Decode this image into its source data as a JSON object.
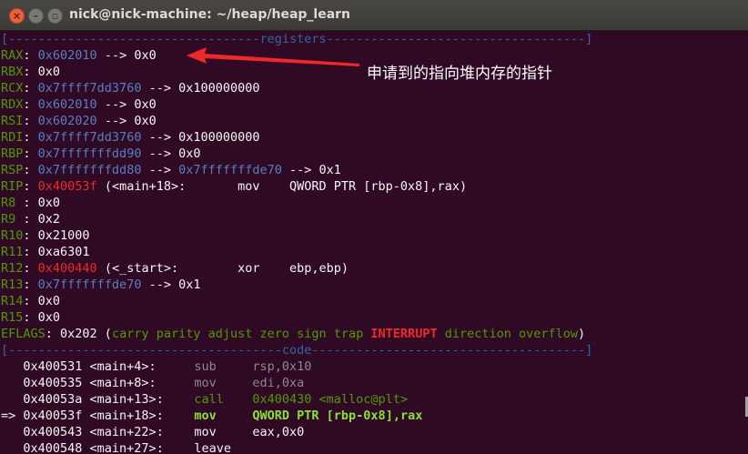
{
  "window": {
    "title": "nick@nick-machine: ~/heap/heap_learn"
  },
  "annotation": "申请到的指向堆内存的指针",
  "terminal": {
    "registers_header": "[----------------------------------registers-----------------------------------]",
    "registers": [
      {
        "name": "RAX",
        "sep": ": ",
        "value": "0x602010",
        "rest": " --> 0x0",
        "value_color": "addr"
      },
      {
        "name": "RBX",
        "sep": ": ",
        "value": "0x0",
        "rest": "",
        "value_color": "white"
      },
      {
        "name": "RCX",
        "sep": ": ",
        "value": "0x7ffff7dd3760",
        "rest": " --> 0x100000000",
        "value_color": "addr"
      },
      {
        "name": "RDX",
        "sep": ": ",
        "value": "0x602010",
        "rest": " --> 0x0",
        "value_color": "addr"
      },
      {
        "name": "RSI",
        "sep": ": ",
        "value": "0x602020",
        "rest": " --> 0x0",
        "value_color": "addr"
      },
      {
        "name": "RDI",
        "sep": ": ",
        "value": "0x7ffff7dd3760",
        "rest": " --> 0x100000000",
        "value_color": "addr"
      },
      {
        "name": "RBP",
        "sep": ": ",
        "value": "0x7fffffffdd90",
        "rest": " --> 0x0",
        "value_color": "addr"
      },
      {
        "name": "RSP",
        "sep": ": ",
        "value": "0x7fffffffdd80",
        "rest": " --> ",
        "extra": "0x7fffffffde70",
        "tail": " --> 0x1",
        "value_color": "addr"
      },
      {
        "name": "RIP",
        "sep": ": ",
        "value": "0x40053f",
        "rest": " (<main+18>:       mov    QWORD PTR [rbp-0x8],rax)",
        "value_color": "red"
      },
      {
        "name": "R8",
        "sep": " : ",
        "value": "0x0",
        "rest": "",
        "value_color": "white"
      },
      {
        "name": "R9",
        "sep": " : ",
        "value": "0x2",
        "rest": "",
        "value_color": "white"
      },
      {
        "name": "R10",
        "sep": ": ",
        "value": "0x21000",
        "rest": "",
        "value_color": "white"
      },
      {
        "name": "R11",
        "sep": ": ",
        "value": "0xa6301",
        "rest": "",
        "value_color": "white"
      },
      {
        "name": "R12",
        "sep": ": ",
        "value": "0x400440",
        "rest": " (<_start>:        xor    ebp,ebp)",
        "value_color": "red"
      },
      {
        "name": "R13",
        "sep": ": ",
        "value": "0x7fffffffde70",
        "rest": " --> 0x1",
        "value_color": "addr"
      },
      {
        "name": "R14",
        "sep": ": ",
        "value": "0x0",
        "rest": "",
        "value_color": "white"
      },
      {
        "name": "R15",
        "sep": ": ",
        "value": "0x0",
        "rest": "",
        "value_color": "white"
      }
    ],
    "eflags": {
      "name": "EFLAGS",
      "value": ": 0x202 (",
      "flags_before": "carry parity adjust zero sign trap ",
      "flag_set": "INTERRUPT",
      "flags_after": " direction overflow",
      "close": ")"
    },
    "code_header": "[-------------------------------------code-------------------------------------]",
    "code": [
      {
        "prefix": "   ",
        "addr": "0x400531 <main+4>:",
        "mnemonic": "sub",
        "operands": "rsp,0x10",
        "style": "grey"
      },
      {
        "prefix": "   ",
        "addr": "0x400535 <main+8>:",
        "mnemonic": "mov",
        "operands": "edi,0xa",
        "style": "grey"
      },
      {
        "prefix": "   ",
        "addr": "0x40053a <main+13>:",
        "mnemonic": "call",
        "operands": "0x400430 <malloc@plt>",
        "style": "call"
      },
      {
        "prefix": "=> ",
        "addr": "0x40053f <main+18>:",
        "mnemonic": "mov",
        "operands": "QWORD PTR [rbp-0x8],rax",
        "style": "current"
      },
      {
        "prefix": "   ",
        "addr": "0x400543 <main+22>:",
        "mnemonic": "mov",
        "operands": "eax,0x0",
        "style": "white"
      },
      {
        "prefix": "   ",
        "addr": "0x400548 <main+27>:",
        "mnemonic": "leave",
        "operands": "",
        "style": "white"
      }
    ]
  }
}
